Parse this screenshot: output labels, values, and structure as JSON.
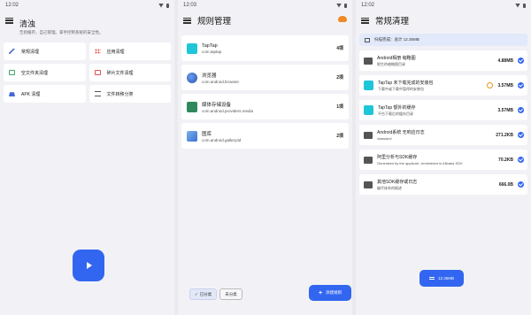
{
  "colors": {
    "accent": "#3266f0",
    "background": "#f2f2f6",
    "card": "#ffffff",
    "warning": "#e39b1a",
    "cloud": "#f08a24"
  },
  "screen1": {
    "status_time": "12:02",
    "title": "清浊",
    "subtitle": "告别缓存，自己管理。掌手控制系统的安全性。",
    "tiles": [
      {
        "label": "常规清理",
        "icon": "broom-icon"
      },
      {
        "label": "应用清理",
        "icon": "app-grid-icon"
      },
      {
        "label": "空文件夹清理",
        "icon": "folder-icon"
      },
      {
        "label": "碎片文件清理",
        "icon": "fragment-file-icon"
      },
      {
        "label": "APK 清理",
        "icon": "android-icon"
      },
      {
        "label": "文件转移分类",
        "icon": "move-icon"
      }
    ],
    "fab_icon": "play-icon"
  },
  "screen2": {
    "status_time": "12:03",
    "title": "规则管理",
    "rules": [
      {
        "name": "TapTap",
        "package": "com.taptap",
        "count": "4项"
      },
      {
        "name": "浏览器",
        "package": "com.android.browser",
        "count": "2项"
      },
      {
        "name": "媒体存储设备",
        "package": "com.android.providers.media",
        "count": "1项"
      },
      {
        "name": "图库",
        "package": "com.android.gallery3d",
        "count": "2项"
      }
    ],
    "filter": {
      "active": "已分类",
      "inactive": "未分类"
    },
    "fab_label": "添建规则"
  },
  "screen3": {
    "status_time": "12:02",
    "title": "常规清理",
    "scan_summary": "扫描完成：总计 12.35MB",
    "items": [
      {
        "name": "Android相册 缩略图",
        "desc": "根生的缩略图目录",
        "size": "4.88MB",
        "icon": "folder-icon",
        "warn": false
      },
      {
        "name": "TapTap 未下载完成的安装包",
        "desc": "下载中或下载中暂停的安装包",
        "size": "3.57MB",
        "icon": "taptap-icon",
        "warn": true
      },
      {
        "name": "TapTap 额外的缓存",
        "desc": "平台下载后的缓存目录",
        "size": "3.57MB",
        "icon": "taptap-icon",
        "warn": false
      },
      {
        "name": "Android系统 无响应日志",
        "desc": "/data/anr/",
        "size": "271.2KB",
        "icon": "folder-icon",
        "warn": false
      },
      {
        "name": "阿里分析与SDK缓存",
        "desc": "Generated by the applicati...embedded in Alibaba SDK",
        "size": "70.2KB",
        "icon": "folder-icon",
        "warn": false
      },
      {
        "name": "其他SDK缓存或日志",
        "desc": "破坏体系的痕迹",
        "size": "666.0B",
        "icon": "folder-icon",
        "warn": false
      }
    ],
    "fab_label": "12.35MB"
  }
}
